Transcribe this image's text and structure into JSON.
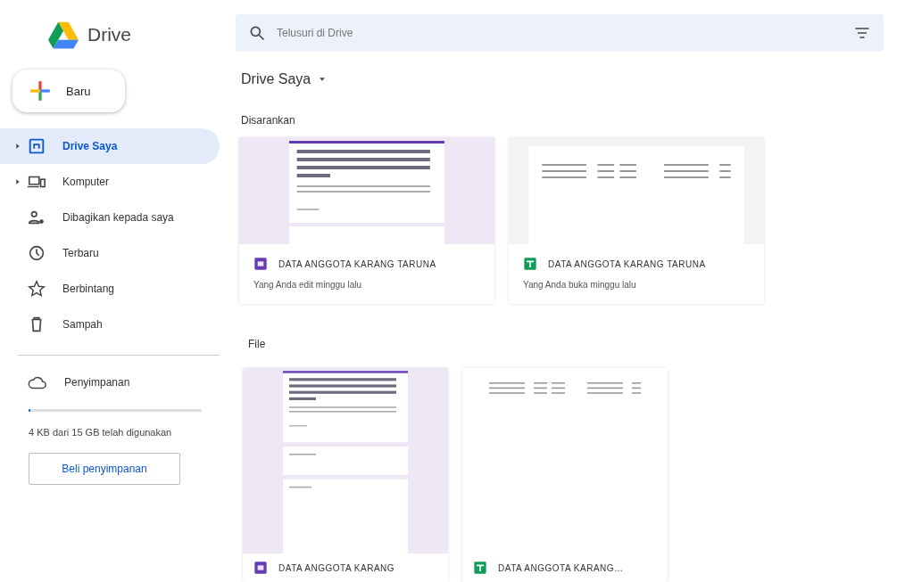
{
  "app": {
    "name": "Drive"
  },
  "new_button": {
    "label": "Baru"
  },
  "sidebar": {
    "items": [
      {
        "kind": "my-drive",
        "label": "Drive Saya",
        "selected": true,
        "expandable": true
      },
      {
        "kind": "computer",
        "label": "Komputer",
        "selected": false,
        "expandable": true
      },
      {
        "kind": "shared",
        "label": "Dibagikan kepada saya",
        "selected": false,
        "expandable": false
      },
      {
        "kind": "recent",
        "label": "Terbaru",
        "selected": false,
        "expandable": false
      },
      {
        "kind": "starred",
        "label": "Berbintang",
        "selected": false,
        "expandable": false
      },
      {
        "kind": "trash",
        "label": "Sampah",
        "selected": false,
        "expandable": false
      }
    ],
    "storage": {
      "label": "Penyimpanan",
      "usage": "4 KB dari 15 GB telah digunakan",
      "button": "Beli penyimpanan",
      "level": 0.01
    }
  },
  "search": {
    "placeholder": "Telusuri di Drive"
  },
  "breadcrumb": {
    "title": "Drive Saya"
  },
  "suggested": {
    "heading": "Disarankan",
    "files": [
      {
        "kind": "form",
        "name": "DATA ANGGOTA KARANG TARUNA",
        "reason": "Yang Anda edit minggu lalu"
      },
      {
        "kind": "sheet",
        "name": "DATA ANGGOTA KARANG TARUNA",
        "reason": "Yang Anda buka minggu lalu"
      }
    ]
  },
  "files": {
    "heading": "File",
    "items": [
      {
        "kind": "form",
        "name": "DATA ANGGOTA KARANG"
      },
      {
        "kind": "sheet",
        "name": "DATA ANGGOTA KARANG…"
      }
    ]
  }
}
